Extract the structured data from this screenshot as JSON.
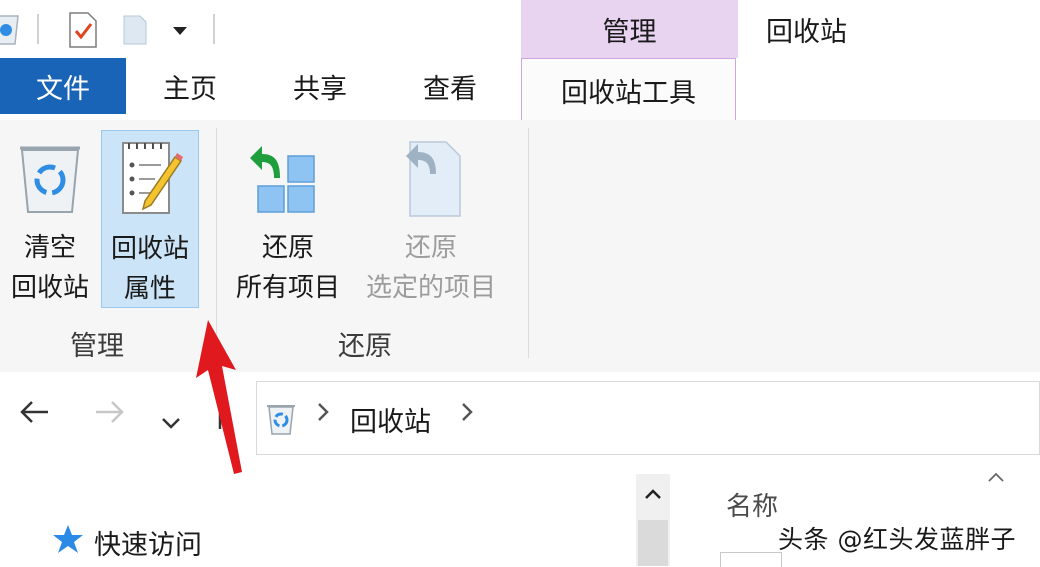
{
  "context_tab": {
    "label": "管理",
    "color": "#e8d3f1"
  },
  "window_title": "回收站",
  "tabs": [
    {
      "label": "文件"
    },
    {
      "label": "主页"
    },
    {
      "label": "共享"
    },
    {
      "label": "查看"
    },
    {
      "label": "回收站工具"
    }
  ],
  "ribbon": {
    "groups": [
      {
        "label": "管理",
        "buttons": [
          {
            "line1": "清空",
            "line2": "回收站",
            "icon": "recycle-bin-icon"
          },
          {
            "line1": "回收站",
            "line2": "属性",
            "icon": "properties-notepad-icon",
            "selected": true
          }
        ]
      },
      {
        "label": "还原",
        "buttons": [
          {
            "line1": "还原",
            "line2": "所有项目",
            "icon": "restore-all-icon"
          },
          {
            "line1": "还原",
            "line2": "选定的项目",
            "icon": "restore-selected-icon",
            "disabled": true
          }
        ]
      }
    ]
  },
  "address_bar": {
    "path": "回收站",
    "icon": "recycle-bin-icon"
  },
  "navigation": {
    "quick_access": "快速访问"
  },
  "file_list": {
    "column_name": "名称"
  },
  "watermark": "头条 @红头发蓝胖子",
  "colors": {
    "file_tab": "#1a64b7",
    "accent_purple": "#e8d3f1",
    "selection": "#cce4f7",
    "arrow_red": "#e0191e"
  }
}
